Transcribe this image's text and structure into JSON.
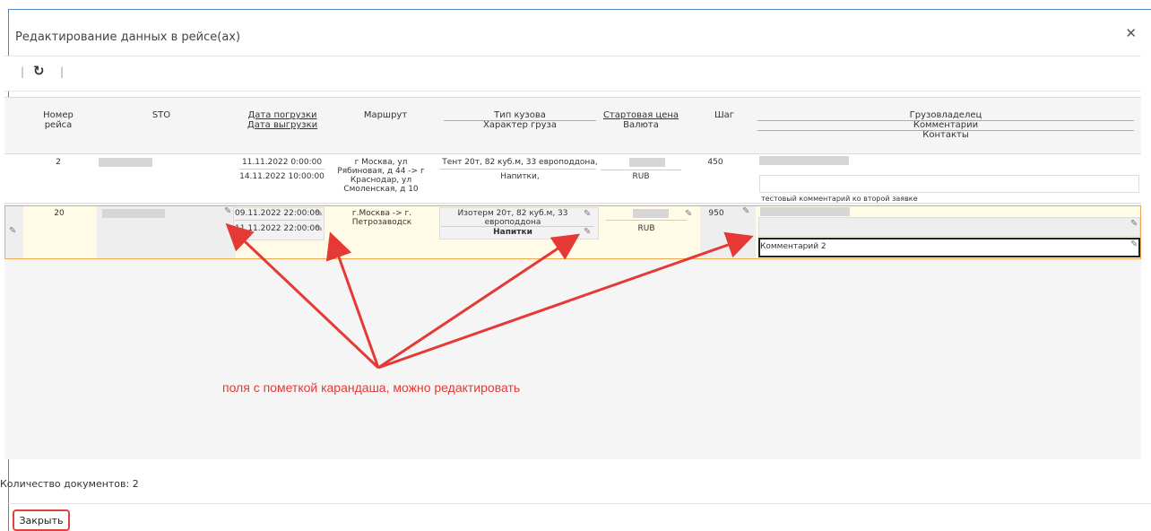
{
  "dialog": {
    "title": "Редактирование данных в рейсе(ах)",
    "close_icon": "close-x-icon"
  },
  "toolbar": {
    "sep_left": "|",
    "sep_right": "|",
    "refresh_icon": "refresh-icon",
    "refresh_glyph": "↻"
  },
  "columns": {
    "num_line1": "Номер",
    "num_line2": "рейса",
    "sto": "STO",
    "date_load": "Дата погрузки",
    "date_unload": "Дата выгрузки",
    "route": "Маршрут",
    "body_type": "Тип кузова",
    "cargo_type": "Характер груза",
    "start_price": "Стартовая цена",
    "currency": "Валюта",
    "step": "Шаг",
    "owner": "Грузовладелец",
    "comments": "Комментарии",
    "contacts": "Контакты"
  },
  "rows": [
    {
      "num": "2",
      "date_load": "11.11.2022 0:00:00",
      "date_unload": "14.11.2022 10:00:00",
      "route_l1": "г Москва, ул",
      "route_l2": "Рябиновая, д 44 -> г",
      "route_l3": "Краснодар, ул",
      "route_l4": "Смоленская, д 10",
      "body": "Тент 20т, 82 куб.м, 33 европоддона,",
      "cargo": "Напитки,",
      "currency": "RUB",
      "step": "450",
      "comment": "тестовый комментарий ко второй заявке"
    },
    {
      "num": "20",
      "date_load": "09.11.2022 22:00:00",
      "date_unload": "11.11.2022 22:00:00",
      "route_l1": "г.Москва -> г.",
      "route_l2": "Петрозаводск",
      "body_l1": "Изотерм 20т, 82 куб.м, 33",
      "body_l2": "европоддона",
      "cargo": "Напитки",
      "currency": "RUB",
      "step": "950",
      "comment": "Комментарий 2"
    }
  ],
  "annotation": "поля с пометкой карандаша, можно редактировать",
  "footer": {
    "count_label": "Количество документов: 2",
    "close_button": "Закрыть"
  },
  "icons": {
    "pencil": "✎",
    "edit_row": "✎"
  },
  "colors": {
    "accent_border": "#4b89c8",
    "selected_row_border": "#f0a850",
    "arrow_red": "#e53935",
    "close_button_border": "#e04040"
  }
}
